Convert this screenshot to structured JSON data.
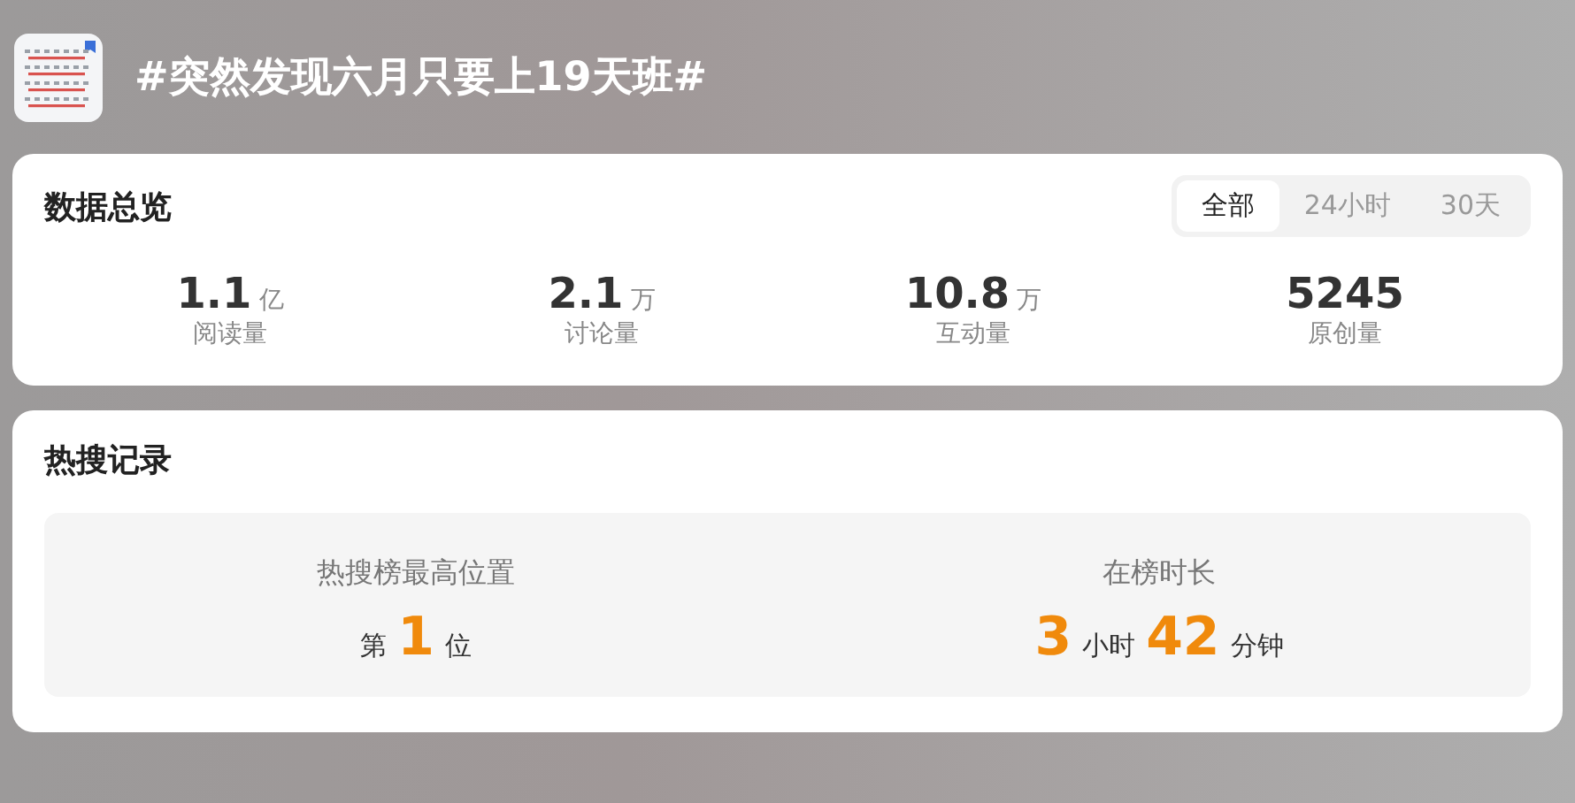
{
  "topic": {
    "title": "#突然发现六月只要上19天班#"
  },
  "overview": {
    "title": "数据总览",
    "tabs": [
      {
        "label": "全部",
        "selected": true
      },
      {
        "label": "24小时",
        "selected": false
      },
      {
        "label": "30天",
        "selected": false
      }
    ],
    "stats": [
      {
        "value": "1.1",
        "unit": "亿",
        "label": "阅读量"
      },
      {
        "value": "2.1",
        "unit": "万",
        "label": "讨论量"
      },
      {
        "value": "10.8",
        "unit": "万",
        "label": "互动量"
      },
      {
        "value": "5245",
        "label": "原创量"
      }
    ]
  },
  "hot_search": {
    "title": "热搜记录",
    "items": [
      {
        "label": "热搜榜最高位置",
        "parts": [
          {
            "kind": "unit",
            "text": "第"
          },
          {
            "kind": "number",
            "text": "1"
          },
          {
            "kind": "unit",
            "text": "位"
          }
        ]
      },
      {
        "label": "在榜时长",
        "parts": [
          {
            "kind": "number",
            "text": "3"
          },
          {
            "kind": "unit",
            "text": "小时"
          },
          {
            "kind": "number",
            "text": "42"
          },
          {
            "kind": "unit",
            "text": "分钟"
          }
        ]
      }
    ]
  }
}
